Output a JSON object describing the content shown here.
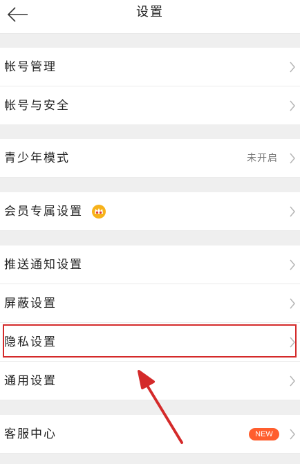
{
  "header": {
    "title": "设置",
    "back_icon": "arrow-left-icon"
  },
  "sections": [
    {
      "items": [
        {
          "label": "帐号管理"
        },
        {
          "label": "帐号与安全"
        }
      ]
    },
    {
      "items": [
        {
          "label": "青少年模式",
          "value": "未开启"
        }
      ]
    },
    {
      "items": [
        {
          "label": "会员专属设置",
          "icon": "crown-icon"
        }
      ]
    },
    {
      "items": [
        {
          "label": "推送通知设置"
        },
        {
          "label": "屏蔽设置"
        },
        {
          "label": "隐私设置",
          "highlighted": true
        },
        {
          "label": "通用设置"
        }
      ]
    },
    {
      "items": [
        {
          "label": "客服中心",
          "badge": "NEW"
        }
      ]
    }
  ],
  "colors": {
    "badge": "#ff5e2e",
    "highlight": "#d42a2a",
    "annotation_arrow": "#d42a2a"
  }
}
